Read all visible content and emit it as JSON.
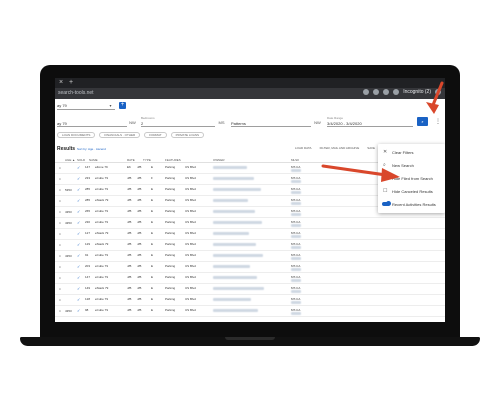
{
  "browser": {
    "tab_close": "×",
    "tab_new": "+",
    "url": "search-tools.net",
    "incognito_label": "Incognito (2)"
  },
  "search": {
    "query": "ay 79",
    "field2_label": "",
    "field2_value": "",
    "field3_label": "Bedrooms",
    "field3_value": "2",
    "field4_value": "Patterns",
    "date_label": "Date Range",
    "date_value": "3/4/2020 - 3/4/2020",
    "mini_labels": [
      "NW",
      "MS",
      "NW"
    ]
  },
  "chips": [
    "LOAN DOCUMENTS",
    "FINANCIALS · OTHER",
    "FORMAT",
    "PRIVATE LOANS"
  ],
  "results": {
    "title": "Results",
    "subtitle": "Sort by: Age · Ascend",
    "load_buttons": [
      "LOAD DATA",
      "FILTER, MAIL AND ARCHIVE",
      "SAVE"
    ]
  },
  "table": {
    "headers": [
      "",
      "AGE ▲",
      "SOLD",
      "NAME",
      "RATE",
      "TYPE",
      "FEATURES",
      "",
      "OWNER",
      "",
      "MLS#"
    ],
    "rows": [
      {
        "age": "",
        "sold": "✓",
        "a": "147",
        "name": "eZone 79",
        "b": "E6",
        "c": "J/B",
        "d": "E",
        "feat": "Parking",
        "e": "US Blvd",
        "mls": "MT-CA"
      },
      {
        "age": "",
        "sold": "✓",
        "a": "233",
        "name": "eCube 79",
        "b": "J/B",
        "c": "J/B",
        "d": "F",
        "feat": "Parking",
        "e": "US Blvd",
        "mls": "MT-CA"
      },
      {
        "age": "5353",
        "sold": "✓",
        "a": "285",
        "name": "eCube 79",
        "b": "J/B",
        "c": "J/B",
        "d": "E",
        "feat": "Parking",
        "e": "US Blvd",
        "mls": "MT-CA"
      },
      {
        "age": "",
        "sold": "✓",
        "a": "285",
        "name": "eStack 79",
        "b": "J/B",
        "c": "J/B",
        "d": "E",
        "feat": "Parking",
        "e": "US Blvd",
        "mls": "MT-CA"
      },
      {
        "age": "4353",
        "sold": "✓",
        "a": "265",
        "name": "eCube 79",
        "b": "J/B",
        "c": "J/B",
        "d": "E",
        "feat": "Parking",
        "e": "US Blvd",
        "mls": "MT-CA"
      },
      {
        "age": "4353",
        "sold": "✓",
        "a": "230",
        "name": "eCube 79",
        "b": "J/B",
        "c": "J/B",
        "d": "E",
        "feat": "Parking",
        "e": "US Blvd",
        "mls": "MT-CA"
      },
      {
        "age": "",
        "sold": "✓",
        "a": "127",
        "name": "eStack 79",
        "b": "J/B",
        "c": "J/B",
        "d": "E",
        "feat": "Parking",
        "e": "US Blvd",
        "mls": "MT-CA"
      },
      {
        "age": "",
        "sold": "✓",
        "a": "129",
        "name": "eStack 79",
        "b": "J/B",
        "c": "J/B",
        "d": "E",
        "feat": "Parking",
        "e": "US Blvd",
        "mls": "MT-CA"
      },
      {
        "age": "4353",
        "sold": "✓",
        "a": "91",
        "name": "eCube 79",
        "b": "J/B",
        "c": "J/B",
        "d": "E",
        "feat": "Parking",
        "e": "US Blvd",
        "mls": "MT-CA"
      },
      {
        "age": "",
        "sold": "✓",
        "a": "203",
        "name": "eCube 79",
        "b": "J/B",
        "c": "J/B",
        "d": "E",
        "feat": "Parking",
        "e": "US Blvd",
        "mls": "MT-CA"
      },
      {
        "age": "",
        "sold": "✓",
        "a": "147",
        "name": "eCube 79",
        "b": "J/B",
        "c": "J/B",
        "d": "E",
        "feat": "Parking",
        "e": "US Blvd",
        "mls": "MT-CA"
      },
      {
        "age": "",
        "sold": "✓",
        "a": "149",
        "name": "eStack 79",
        "b": "J/B",
        "c": "J/B",
        "d": "E",
        "feat": "Parking",
        "e": "US Blvd",
        "mls": "MT-CA"
      },
      {
        "age": "",
        "sold": "✓",
        "a": "128",
        "name": "eCube 79",
        "b": "J/B",
        "c": "J/B",
        "d": "E",
        "feat": "Parking",
        "e": "US Blvd",
        "mls": "MT-CA"
      },
      {
        "age": "4353",
        "sold": "✓",
        "a": "98",
        "name": "eCube 79",
        "b": "J/B",
        "c": "J/B",
        "d": "E",
        "feat": "Parking",
        "e": "US Blvd",
        "mls": "MT-CA"
      }
    ]
  },
  "menu": {
    "items": [
      {
        "icon": "close-icon",
        "glyph": "✕",
        "label": "Clear Filters"
      },
      {
        "icon": "search-icon",
        "glyph": "⌕",
        "label": "New Search"
      },
      {
        "icon": "person-icon",
        "glyph": "👤",
        "label": "Hide Filed from Search"
      },
      {
        "icon": "checkbox-icon",
        "glyph": "☐",
        "label": "Hide Canceled Results"
      },
      {
        "icon": "toggle-icon",
        "glyph": "",
        "label": "Recent Activities Results"
      }
    ]
  },
  "colors": {
    "accent": "#1a62c4",
    "arrow": "#d9472b"
  }
}
